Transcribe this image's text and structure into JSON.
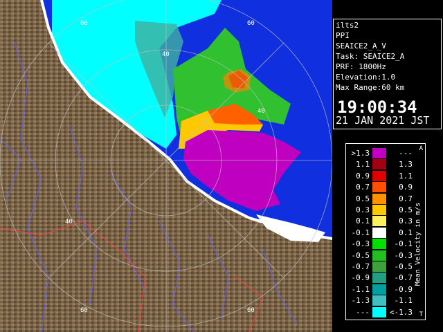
{
  "info": {
    "station": "ilts2",
    "product": "PPI",
    "field": "SEAICE2_A_V",
    "task": "Task: SEAICE2_A",
    "prf": "PRF: 1800Hz",
    "elevation": "Elevation:1.0",
    "max_range": "Max Range:60 km",
    "time": "19:00:34",
    "date": "21 JAN 2021 JST"
  },
  "range_labels": [
    "60",
    "60",
    "40",
    "40",
    "40",
    "40",
    "60",
    "60"
  ],
  "legend": {
    "title": "Mean Velocity in m/s",
    "corner_top": "A",
    "corner_bottom": "T",
    "rows": [
      {
        "lo": ">1.3",
        "hi": "---",
        "color": "#c000c0"
      },
      {
        "lo": "1.1",
        "hi": "1.3",
        "color": "#a00010"
      },
      {
        "lo": "0.9",
        "hi": "1.1",
        "color": "#e00000"
      },
      {
        "lo": "0.7",
        "hi": "0.9",
        "color": "#ff5000"
      },
      {
        "lo": "0.5",
        "hi": "0.7",
        "color": "#ff9000"
      },
      {
        "lo": "0.3",
        "hi": "0.5",
        "color": "#ffc800"
      },
      {
        "lo": "0.1",
        "hi": "0.3",
        "color": "#fff060"
      },
      {
        "lo": "-0.1",
        "hi": "0.1",
        "color": "#ffffff"
      },
      {
        "lo": "-0.3",
        "hi": "-0.1",
        "color": "#00e000"
      },
      {
        "lo": "-0.5",
        "hi": "-0.3",
        "color": "#20c020"
      },
      {
        "lo": "-0.7",
        "hi": "-0.5",
        "color": "#40a040"
      },
      {
        "lo": "-0.9",
        "hi": "-0.7",
        "color": "#20a080"
      },
      {
        "lo": "-1.1",
        "hi": "-0.9",
        "color": "#00a0a0"
      },
      {
        "lo": "-1.3",
        "hi": "-1.1",
        "color": "#40c0c0"
      },
      {
        "lo": "---",
        "hi": "<-1.3",
        "color": "#00ffff"
      }
    ]
  },
  "colors": {
    "land": "#7a6448",
    "sea": "#1030e0",
    "coast_white": "#ffffff",
    "river": "#6060ff",
    "border": "#ff4040",
    "range_ring": "#c0c0c0"
  }
}
